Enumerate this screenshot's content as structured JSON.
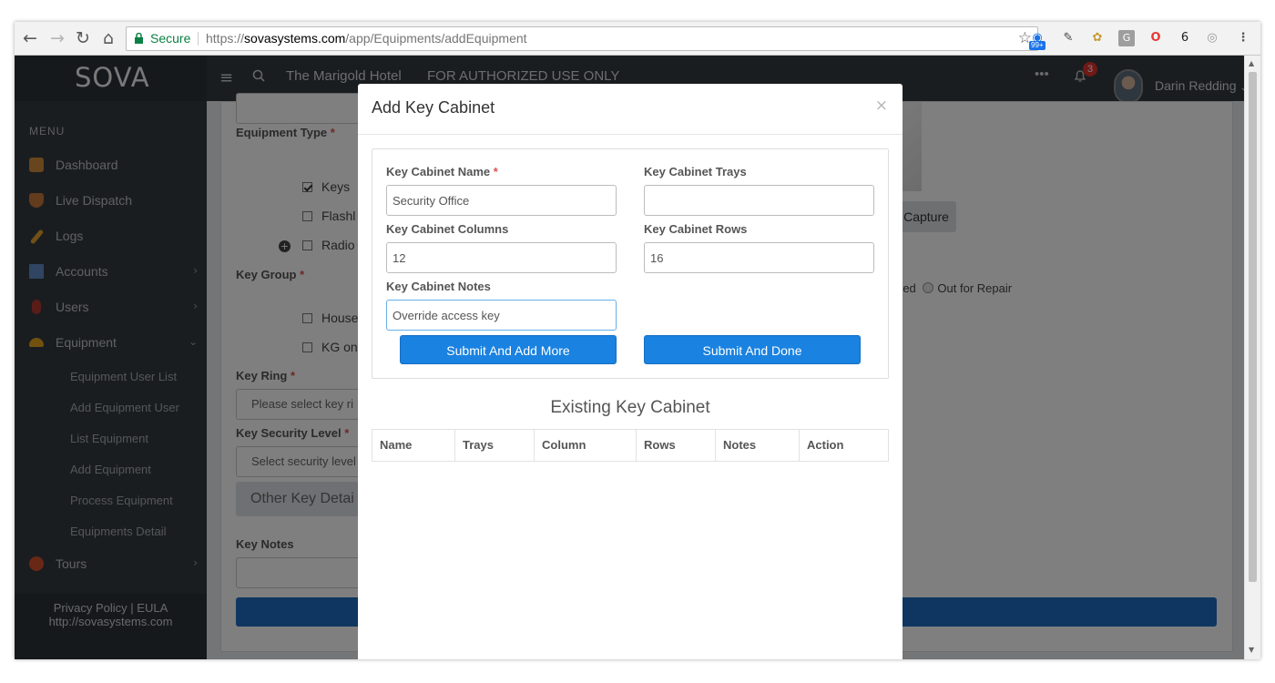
{
  "browser": {
    "secure_label": "Secure",
    "url_scheme": "https://",
    "url_host": "sovasystems.com",
    "url_path": "/app/Equipments/addEquipment",
    "ext_badge": "99+"
  },
  "topbar": {
    "logo": "SOVA",
    "hotel": "The Marigold Hotel",
    "notice": "FOR AUTHORIZED USE ONLY",
    "more": "•••",
    "notification_count": "3",
    "user_name": "Darin Redding"
  },
  "sidebar": {
    "menu_heading": "MENU",
    "items": [
      {
        "label": "Dashboard",
        "icon": "home-icon",
        "color": "#d08a3a"
      },
      {
        "label": "Live Dispatch",
        "icon": "shield-icon",
        "color": "#c7763a"
      },
      {
        "label": "Logs",
        "icon": "pencil-icon",
        "color": "#e0a030"
      },
      {
        "label": "Accounts",
        "icon": "building-icon",
        "color": "#5f8bc4"
      },
      {
        "label": "Users",
        "icon": "user-icon",
        "color": "#b5382f"
      },
      {
        "label": "Equipment",
        "icon": "helmet-icon",
        "color": "#e3a21a"
      },
      {
        "label": "Tours",
        "icon": "compass-icon",
        "color": "#d0502a"
      }
    ],
    "equipment_sub": [
      "Equipment User List",
      "Add Equipment User",
      "List Equipment",
      "Add Equipment",
      "Process Equipment",
      "Equipments Detail"
    ],
    "footer_links": "Privacy Policy | EULA",
    "footer_url": "http://sovasystems.com"
  },
  "background_form": {
    "equipment_type_label": "Equipment Type",
    "equipment_types": [
      "Keys",
      "Flashl",
      "Radio"
    ],
    "key_group_label": "Key Group",
    "key_groups": [
      "House",
      "KG on"
    ],
    "key_ring_label": "Key Ring",
    "key_ring_placeholder": "Please select key ri",
    "security_level_label": "Key Security Level",
    "security_level_placeholder": "Select security level",
    "other_details": "Other Key Detai",
    "key_notes_label": "Key Notes",
    "capture_button": "Capture",
    "status_partial": "red",
    "status_out_for_repair": "Out for Repair"
  },
  "modal": {
    "title": "Add Key Cabinet",
    "close": "×",
    "name_label": "Key Cabinet Name",
    "name_value": "Security Office",
    "trays_label": "Key Cabinet Trays",
    "trays_value": "",
    "columns_label": "Key Cabinet Columns",
    "columns_value": "12",
    "rows_label": "Key Cabinet Rows",
    "rows_value": "16",
    "notes_label": "Key Cabinet Notes",
    "notes_value": "Override access key",
    "submit_more": "Submit And Add More",
    "submit_done": "Submit And Done",
    "existing_title": "Existing Key Cabinet",
    "table_headers": [
      "Name",
      "Trays",
      "Column",
      "Rows",
      "Notes",
      "Action"
    ]
  },
  "colors": {
    "primary": "#1a82e0",
    "sidebar_bg": "#353a40",
    "required": "#d9534f",
    "secure_green": "#0b8043"
  }
}
